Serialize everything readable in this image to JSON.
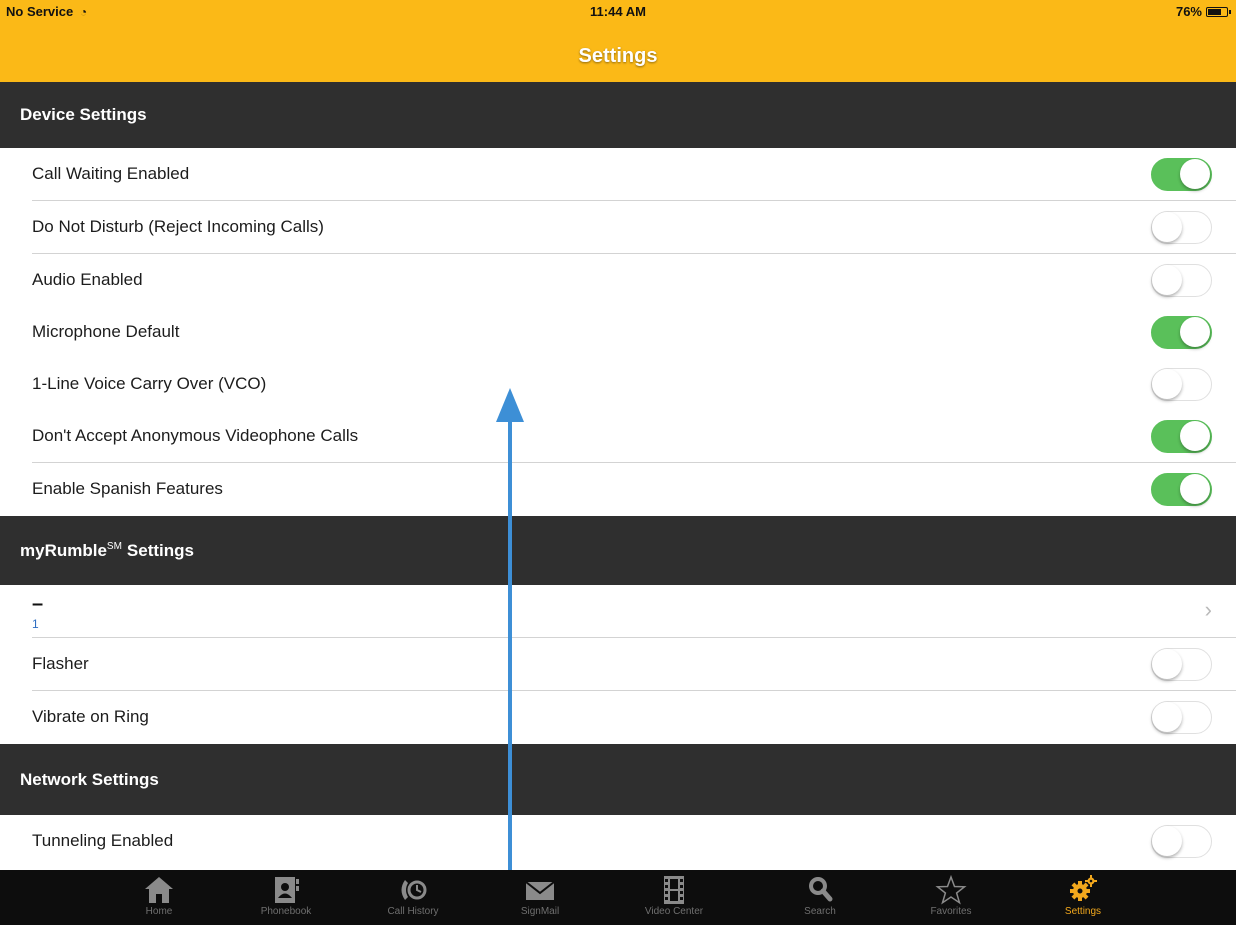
{
  "status_bar": {
    "carrier": "No Service",
    "time": "11:44 AM",
    "battery": "76%",
    "battery_fraction": 0.76
  },
  "nav": {
    "title": "Settings"
  },
  "sections": {
    "device": {
      "title": "Device Settings",
      "rows": [
        {
          "label": "Call Waiting Enabled",
          "on": true
        },
        {
          "label": "Do Not Disturb (Reject Incoming Calls)",
          "on": false
        },
        {
          "label": "Audio Enabled",
          "on": false
        },
        {
          "label": "Microphone Default",
          "on": true
        },
        {
          "label": "1-Line Voice Carry Over (VCO)",
          "on": false
        },
        {
          "label": "Don't Accept Anonymous Videophone Calls",
          "on": true
        },
        {
          "label": "Enable Spanish Features",
          "on": true
        }
      ]
    },
    "myrumble": {
      "title_prefix": "myRumble",
      "title_sup": "SM",
      "title_suffix": "Settings",
      "link_row": {
        "title": "–",
        "subtitle": "1",
        "chevron": "›"
      },
      "rows": [
        {
          "label": "Flasher",
          "on": false
        },
        {
          "label": "Vibrate on Ring",
          "on": false
        }
      ]
    },
    "network": {
      "title": "Network Settings",
      "rows": [
        {
          "label": "Tunneling Enabled",
          "on": false
        }
      ]
    }
  },
  "tabs": [
    {
      "label": "Home",
      "icon": "home-icon"
    },
    {
      "label": "Phonebook",
      "icon": "phonebook-icon"
    },
    {
      "label": "Call History",
      "icon": "call-history-icon"
    },
    {
      "label": "SignMail",
      "icon": "signmail-icon"
    },
    {
      "label": "Video Center",
      "icon": "video-center-icon"
    },
    {
      "label": "Search",
      "icon": "search-icon"
    },
    {
      "label": "Favorites",
      "icon": "favorites-icon"
    },
    {
      "label": "Settings",
      "icon": "settings-icon",
      "active": true
    }
  ],
  "colors": {
    "nav": "#fbb917",
    "section": "#2f2f2f",
    "toggle_on": "#5ac05a",
    "active_tab": "#f2a81d",
    "arrow": "#3d8fd6"
  }
}
